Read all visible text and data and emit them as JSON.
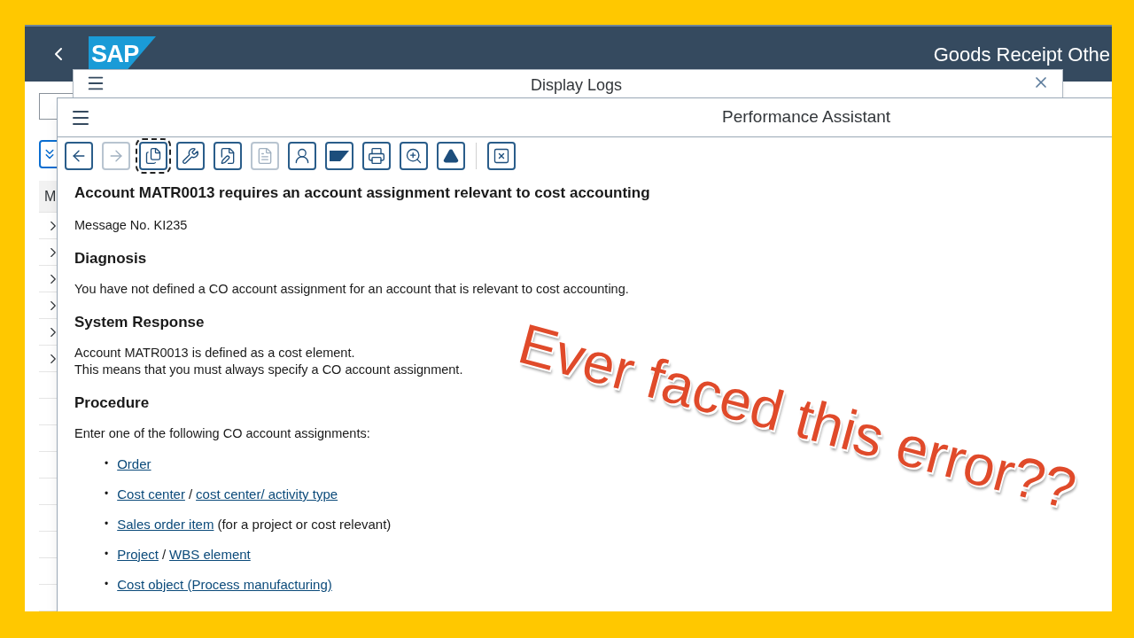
{
  "shell": {
    "logo": "SAP",
    "title": "Goods Receipt Othe"
  },
  "background_table": {
    "column_1": "M",
    "rows": [
      {
        "expandable": true
      },
      {
        "expandable": true
      },
      {
        "expandable": true
      },
      {
        "expandable": true
      },
      {
        "expandable": true
      },
      {
        "expandable": true
      },
      {
        "expandable": false
      },
      {
        "expandable": false
      },
      {
        "expandable": false
      },
      {
        "expandable": false
      },
      {
        "expandable": false
      },
      {
        "expandable": false
      },
      {
        "expandable": false
      },
      {
        "expandable": false
      },
      {
        "expandable": false
      }
    ]
  },
  "back_dialog": {
    "title": "Display Logs"
  },
  "dialog": {
    "title": "Performance Assistant",
    "toolbar": [
      {
        "kind": "back",
        "disabled": false,
        "focused": false
      },
      {
        "kind": "forward",
        "disabled": true,
        "focused": false
      },
      {
        "kind": "copy",
        "disabled": false,
        "focused": true
      },
      {
        "kind": "wrench",
        "disabled": false,
        "focused": false
      },
      {
        "kind": "edit",
        "disabled": false,
        "focused": false
      },
      {
        "kind": "globe-doc",
        "disabled": true,
        "focused": false
      },
      {
        "kind": "person",
        "disabled": false,
        "focused": false
      },
      {
        "kind": "sap",
        "disabled": false,
        "focused": false
      },
      {
        "kind": "print",
        "disabled": false,
        "focused": false
      },
      {
        "kind": "zoom",
        "disabled": false,
        "focused": false
      },
      {
        "kind": "triangle",
        "disabled": false,
        "focused": false
      },
      {
        "kind": "separator"
      },
      {
        "kind": "close",
        "disabled": false,
        "focused": false
      }
    ],
    "title_text": "Account MATR0013 requires an account assignment relevant to cost accounting",
    "message_no": "Message No. KI235",
    "sections": [
      {
        "heading": "Diagnosis",
        "paragraphs": [
          "You have not defined a CO account assignment for an account that is relevant to cost accounting."
        ]
      },
      {
        "heading": "System Response",
        "paragraphs": [
          "Account MATR0013 is defined as a cost element.",
          "This means that you must always specify a CO account assignment."
        ]
      },
      {
        "heading": "Procedure",
        "paragraphs": [
          "Enter one of the following CO account assignments:"
        ]
      }
    ],
    "list": [
      {
        "bullet": "•",
        "parts": [
          {
            "kind": "link",
            "text": "Order"
          }
        ]
      },
      {
        "bullet": "•",
        "parts": [
          {
            "kind": "link",
            "text": "Cost center"
          },
          {
            "kind": "text",
            "text": "/"
          },
          {
            "kind": "link",
            "text": "cost center/ activity type"
          }
        ]
      },
      {
        "bullet": "•",
        "parts": [
          {
            "kind": "link",
            "text": "Sales order item"
          },
          {
            "kind": "text",
            "text": "(for a project or cost relevant)"
          }
        ]
      },
      {
        "bullet": "•",
        "parts": [
          {
            "kind": "link",
            "text": "Project"
          },
          {
            "kind": "text",
            "text": "/"
          },
          {
            "kind": "link",
            "text": "WBS element"
          }
        ]
      },
      {
        "bullet": "•",
        "parts": [
          {
            "kind": "link",
            "text": "Cost object (Process manufacturing)"
          }
        ]
      }
    ]
  },
  "overlay_caption": "Ever faced this error??"
}
